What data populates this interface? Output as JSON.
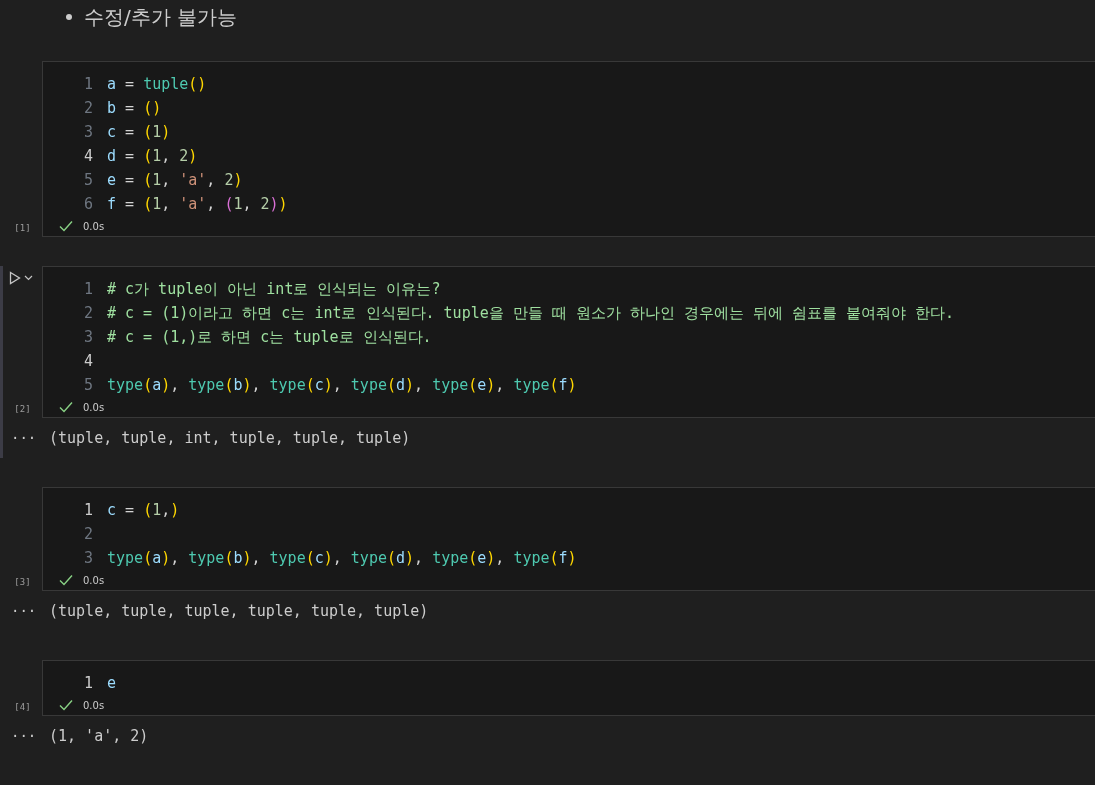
{
  "heading": {
    "text": "수정/추가 불가능"
  },
  "cells": [
    {
      "focused": false,
      "exec": "[1]",
      "success": true,
      "time": "0.0s",
      "lines": [
        {
          "no": "1",
          "active": false,
          "tokens": [
            {
              "kind": "var",
              "text": "a"
            },
            {
              "kind": "plain",
              "text": " = "
            },
            {
              "kind": "func",
              "text": "tuple"
            },
            {
              "kind": "paren",
              "text": "()"
            }
          ]
        },
        {
          "no": "2",
          "active": false,
          "tokens": [
            {
              "kind": "var",
              "text": "b"
            },
            {
              "kind": "plain",
              "text": " = "
            },
            {
              "kind": "paren",
              "text": "()"
            }
          ]
        },
        {
          "no": "3",
          "active": false,
          "tokens": [
            {
              "kind": "var",
              "text": "c"
            },
            {
              "kind": "plain",
              "text": " = "
            },
            {
              "kind": "paren",
              "text": "("
            },
            {
              "kind": "num",
              "text": "1"
            },
            {
              "kind": "paren",
              "text": ")"
            }
          ]
        },
        {
          "no": "4",
          "active": true,
          "tokens": [
            {
              "kind": "var",
              "text": "d"
            },
            {
              "kind": "plain",
              "text": " = "
            },
            {
              "kind": "paren",
              "text": "("
            },
            {
              "kind": "num",
              "text": "1"
            },
            {
              "kind": "plain",
              "text": ", "
            },
            {
              "kind": "num",
              "text": "2"
            },
            {
              "kind": "paren",
              "text": ")"
            }
          ]
        },
        {
          "no": "5",
          "active": false,
          "tokens": [
            {
              "kind": "var",
              "text": "e"
            },
            {
              "kind": "plain",
              "text": " = "
            },
            {
              "kind": "paren",
              "text": "("
            },
            {
              "kind": "num",
              "text": "1"
            },
            {
              "kind": "plain",
              "text": ", "
            },
            {
              "kind": "str",
              "text": "'a'"
            },
            {
              "kind": "plain",
              "text": ", "
            },
            {
              "kind": "num",
              "text": "2"
            },
            {
              "kind": "paren",
              "text": ")"
            }
          ]
        },
        {
          "no": "6",
          "active": false,
          "tokens": [
            {
              "kind": "var",
              "text": "f"
            },
            {
              "kind": "plain",
              "text": " = "
            },
            {
              "kind": "paren",
              "text": "("
            },
            {
              "kind": "num",
              "text": "1"
            },
            {
              "kind": "plain",
              "text": ", "
            },
            {
              "kind": "str",
              "text": "'a'"
            },
            {
              "kind": "plain",
              "text": ", "
            },
            {
              "kind": "paren2",
              "text": "("
            },
            {
              "kind": "num",
              "text": "1"
            },
            {
              "kind": "plain",
              "text": ", "
            },
            {
              "kind": "num",
              "text": "2"
            },
            {
              "kind": "paren2",
              "text": ")"
            },
            {
              "kind": "paren",
              "text": ")"
            }
          ]
        }
      ]
    },
    {
      "focused": true,
      "exec": "[2]",
      "success": true,
      "time": "0.0s",
      "lines": [
        {
          "no": "1",
          "active": false,
          "tokens": [
            {
              "kind": "comment",
              "text": "# c가 tuple이 아닌 int로 인식되는 이유는?"
            }
          ]
        },
        {
          "no": "2",
          "active": false,
          "tokens": [
            {
              "kind": "comment",
              "text": "# c = (1)이라고 하면 c는 int로 인식된다. tuple을 만들 때 원소가 하나인 경우에는 뒤에 쉼표를 붙여줘야 한다."
            }
          ]
        },
        {
          "no": "3",
          "active": false,
          "tokens": [
            {
              "kind": "comment",
              "text": "# c = (1,)로 하면 c는 tuple로 인식된다."
            }
          ]
        },
        {
          "no": "4",
          "active": true
        },
        {
          "no": "5",
          "active": false,
          "tokens": [
            {
              "kind": "func",
              "text": "type"
            },
            {
              "kind": "paren",
              "text": "("
            },
            {
              "kind": "var",
              "text": "a"
            },
            {
              "kind": "paren",
              "text": ")"
            },
            {
              "kind": "plain",
              "text": ", "
            },
            {
              "kind": "func",
              "text": "type"
            },
            {
              "kind": "paren",
              "text": "("
            },
            {
              "kind": "var",
              "text": "b"
            },
            {
              "kind": "paren",
              "text": ")"
            },
            {
              "kind": "plain",
              "text": ", "
            },
            {
              "kind": "func",
              "text": "type"
            },
            {
              "kind": "paren",
              "text": "("
            },
            {
              "kind": "var",
              "text": "c"
            },
            {
              "kind": "paren",
              "text": ")"
            },
            {
              "kind": "plain",
              "text": ", "
            },
            {
              "kind": "func",
              "text": "type"
            },
            {
              "kind": "paren",
              "text": "("
            },
            {
              "kind": "var",
              "text": "d"
            },
            {
              "kind": "paren",
              "text": ")"
            },
            {
              "kind": "plain",
              "text": ", "
            },
            {
              "kind": "func",
              "text": "type"
            },
            {
              "kind": "paren",
              "text": "("
            },
            {
              "kind": "var",
              "text": "e"
            },
            {
              "kind": "paren",
              "text": ")"
            },
            {
              "kind": "plain",
              "text": ", "
            },
            {
              "kind": "func",
              "text": "type"
            },
            {
              "kind": "paren",
              "text": "("
            },
            {
              "kind": "var",
              "text": "f"
            },
            {
              "kind": "paren",
              "text": ")"
            }
          ]
        }
      ],
      "output": {
        "more": "···",
        "text": "(tuple, tuple, int, tuple, tuple, tuple)"
      }
    },
    {
      "focused": false,
      "exec": "[3]",
      "success": true,
      "time": "0.0s",
      "lines": [
        {
          "no": "1",
          "active": true,
          "tokens": [
            {
              "kind": "var",
              "text": "c"
            },
            {
              "kind": "plain",
              "text": " = "
            },
            {
              "kind": "paren",
              "text": "("
            },
            {
              "kind": "num",
              "text": "1"
            },
            {
              "kind": "plain",
              "text": ","
            },
            {
              "kind": "paren",
              "text": ")"
            }
          ]
        },
        {
          "no": "2",
          "active": false
        },
        {
          "no": "3",
          "active": false,
          "tokens": [
            {
              "kind": "func",
              "text": "type"
            },
            {
              "kind": "paren",
              "text": "("
            },
            {
              "kind": "var",
              "text": "a"
            },
            {
              "kind": "paren",
              "text": ")"
            },
            {
              "kind": "plain",
              "text": ", "
            },
            {
              "kind": "func",
              "text": "type"
            },
            {
              "kind": "paren",
              "text": "("
            },
            {
              "kind": "var",
              "text": "b"
            },
            {
              "kind": "paren",
              "text": ")"
            },
            {
              "kind": "plain",
              "text": ", "
            },
            {
              "kind": "func",
              "text": "type"
            },
            {
              "kind": "paren",
              "text": "("
            },
            {
              "kind": "var",
              "text": "c"
            },
            {
              "kind": "paren",
              "text": ")"
            },
            {
              "kind": "plain",
              "text": ", "
            },
            {
              "kind": "func",
              "text": "type"
            },
            {
              "kind": "paren",
              "text": "("
            },
            {
              "kind": "var",
              "text": "d"
            },
            {
              "kind": "paren",
              "text": ")"
            },
            {
              "kind": "plain",
              "text": ", "
            },
            {
              "kind": "func",
              "text": "type"
            },
            {
              "kind": "paren",
              "text": "("
            },
            {
              "kind": "var",
              "text": "e"
            },
            {
              "kind": "paren",
              "text": ")"
            },
            {
              "kind": "plain",
              "text": ", "
            },
            {
              "kind": "func",
              "text": "type"
            },
            {
              "kind": "paren",
              "text": "("
            },
            {
              "kind": "var",
              "text": "f"
            },
            {
              "kind": "paren",
              "text": ")"
            }
          ]
        }
      ],
      "output": {
        "more": "···",
        "text": "(tuple, tuple, tuple, tuple, tuple, tuple)"
      }
    },
    {
      "focused": false,
      "exec": "[4]",
      "success": true,
      "time": "0.0s",
      "lines": [
        {
          "no": "1",
          "active": true,
          "tokens": [
            {
              "kind": "var",
              "text": "e"
            }
          ]
        }
      ],
      "output": {
        "more": "···",
        "text": "(1, 'a', 2)"
      }
    }
  ]
}
